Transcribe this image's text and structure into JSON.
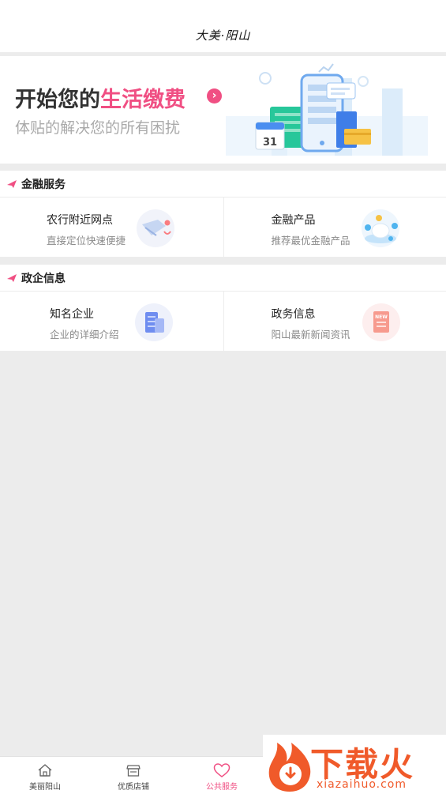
{
  "header": {
    "logo_text": "大美·阳山"
  },
  "banner": {
    "title_plain": "开始您的",
    "title_accent": "生活缴费",
    "arrow": "›",
    "subtitle": "体贴的解决您的所有困扰",
    "calendar_number": "31"
  },
  "finance": {
    "title": "金融服务",
    "items": [
      {
        "title": "农行附近网点",
        "subtitle": "直接定位快速便捷",
        "icon": "map-location-icon"
      },
      {
        "title": "金融产品",
        "subtitle": "推荐最优金融产品",
        "icon": "piggy-bank-icon"
      }
    ]
  },
  "gov": {
    "title": "政企信息",
    "items": [
      {
        "title": "知名企业",
        "subtitle": "企业的详细介绍",
        "icon": "building-icon"
      },
      {
        "title": "政务信息",
        "subtitle": "阳山最新新闻资讯",
        "icon": "news-icon",
        "badge": "NEW"
      }
    ]
  },
  "tabbar": {
    "tabs": [
      {
        "label": "美丽阳山",
        "icon": "home-icon",
        "active": false
      },
      {
        "label": "优质店铺",
        "icon": "shop-icon",
        "active": false
      },
      {
        "label": "公共服务",
        "icon": "heart-icon",
        "active": true
      }
    ]
  },
  "watermark": {
    "text": "下载火",
    "url": "xiazaihuo.com"
  },
  "colors": {
    "accent": "#f04f83",
    "watermark": "#f05a2a"
  }
}
